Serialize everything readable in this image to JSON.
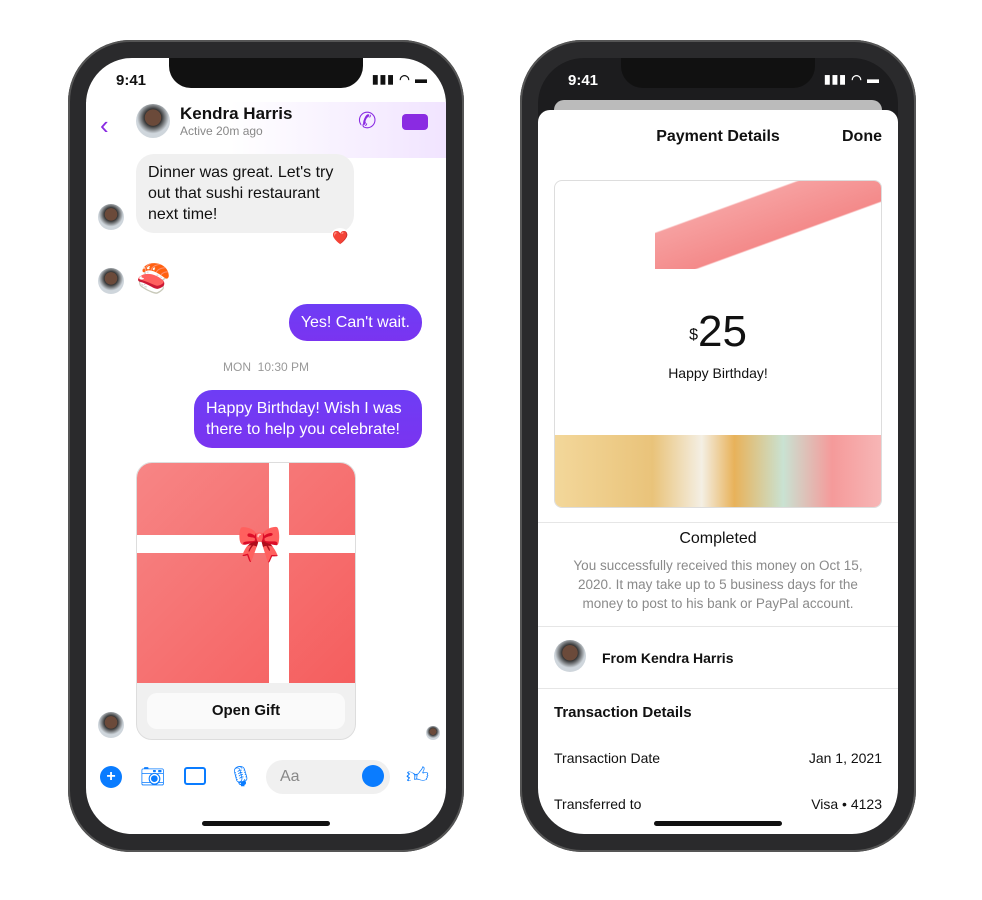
{
  "status_time": "9:41",
  "chat": {
    "contact_name": "Kendra Harris",
    "contact_status": "Active 20m ago",
    "messages": [
      {
        "from": "them",
        "text": "Dinner was great. Let's try out that sushi restaurant next time!",
        "reaction": "❤️"
      },
      {
        "from": "them",
        "text": "🍣"
      },
      {
        "from": "me",
        "text": "Yes! Can't wait."
      },
      {
        "from": "me",
        "text": "Happy Birthday! Wish I was there to help you celebrate!"
      }
    ],
    "timestamp": "MON  10:30 PM",
    "gift_button": "Open Gift",
    "composer_placeholder": "Aa",
    "accent": "#7b2ff7"
  },
  "payment": {
    "title": "Payment Details",
    "done_label": "Done",
    "currency": "$",
    "amount": "25",
    "note": "Happy Birthday!",
    "status": "Completed",
    "status_desc": "You successfully received this money on Oct 15, 2020. It may take up to 5 business days for the money to post to his bank or PayPal account.",
    "from": "From Kendra Harris",
    "details_title": "Transaction Details",
    "details": [
      {
        "label": "Transaction Date",
        "value": "Jan 1, 2021"
      },
      {
        "label": "Transferred to",
        "value": "Visa • 4123"
      }
    ]
  }
}
